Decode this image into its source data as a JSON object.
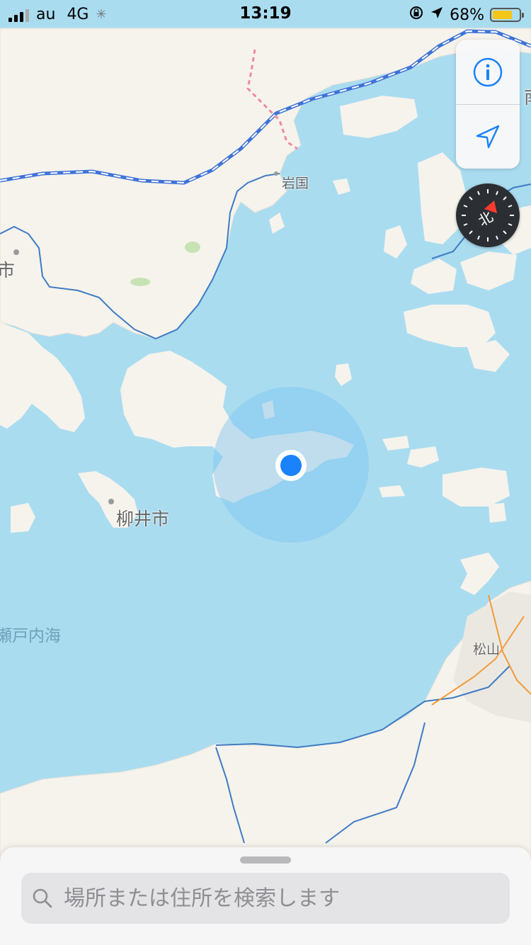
{
  "status_bar": {
    "carrier": "au",
    "network": "4G",
    "time": "13:19",
    "battery_percent": "68%",
    "battery_level": 0.68
  },
  "map": {
    "labels": {
      "iwakuni": "岩国",
      "yanai": "柳井市",
      "matsuyama": "松山",
      "setonaikai": "瀬戸内海",
      "left_edge": "市",
      "right_edge": "南"
    }
  },
  "controls": {
    "info_icon": "info-icon",
    "location_icon": "location-arrow-icon",
    "compass_label": "北"
  },
  "search": {
    "placeholder": "場所または住所を検索します"
  },
  "colors": {
    "water": "#aadcf0",
    "land": "#f6f3ec",
    "accent": "#1a82fb",
    "railway": "#3f73d8",
    "border": "#3e7bc4",
    "road_orange": "#f29a3a"
  }
}
